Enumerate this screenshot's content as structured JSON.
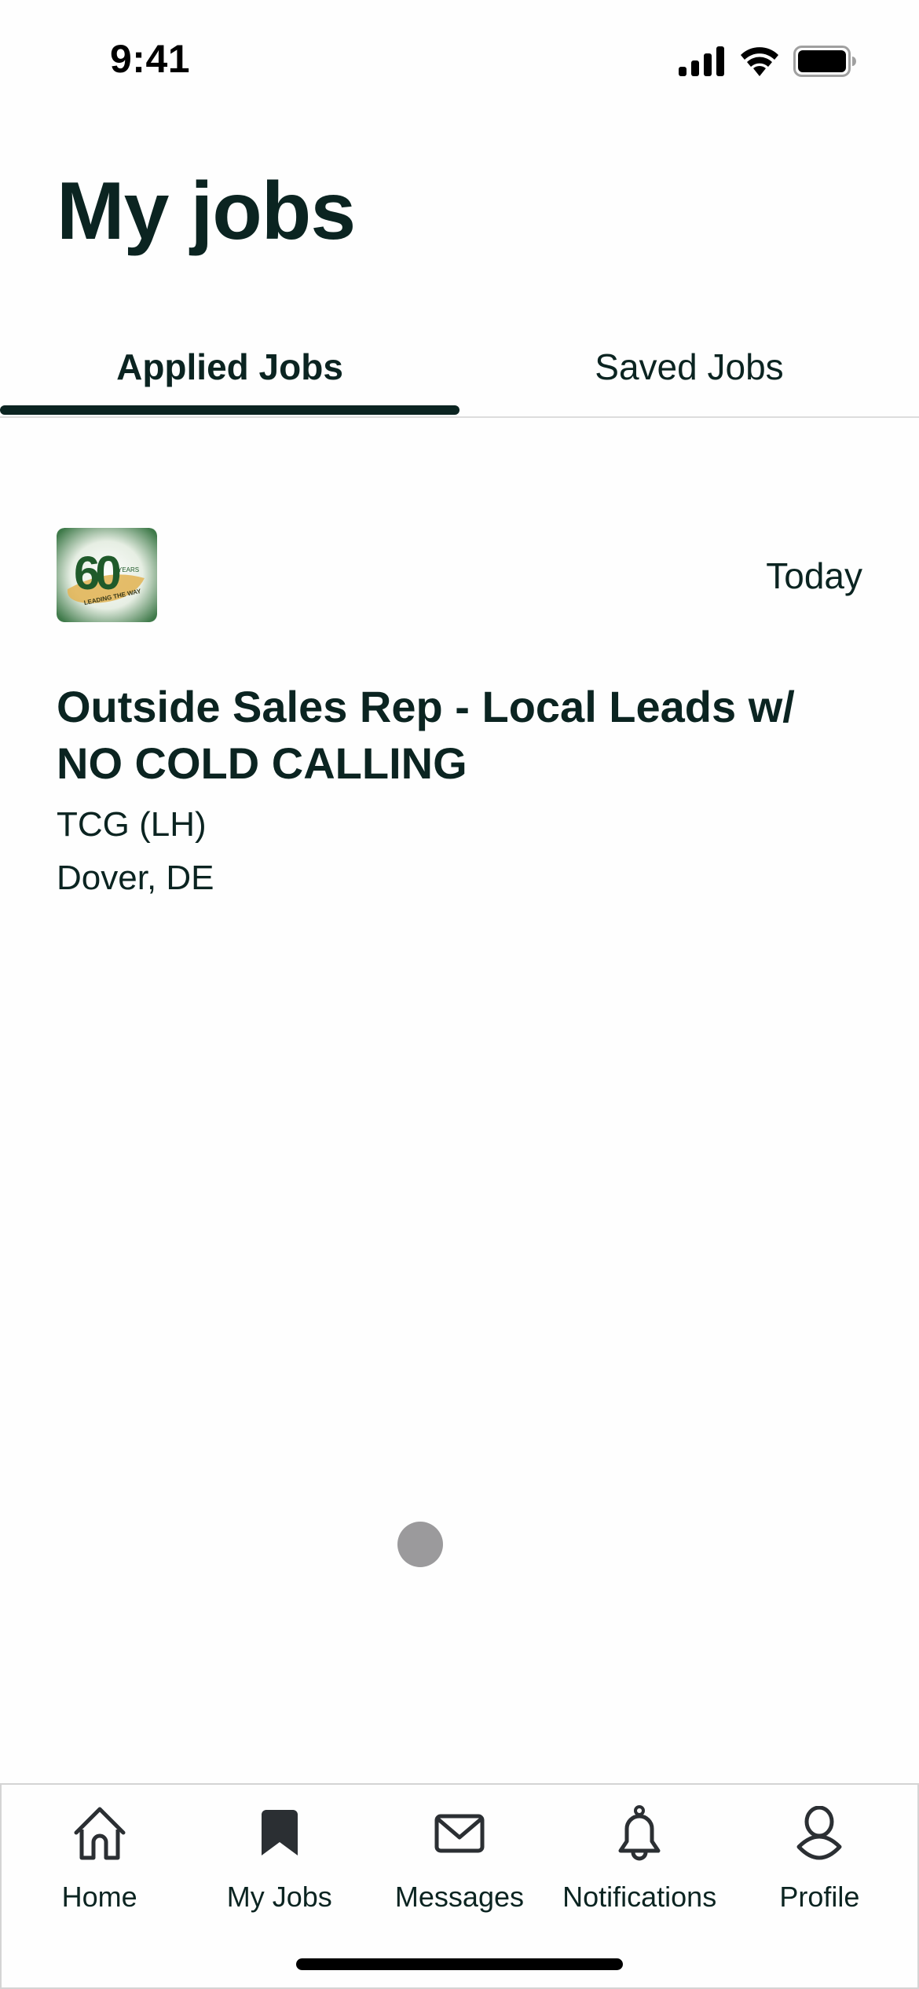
{
  "status_bar": {
    "time": "9:41",
    "icons": [
      "cellular-signal-icon",
      "wifi-icon",
      "battery-icon"
    ]
  },
  "header": {
    "title": "My jobs"
  },
  "tabs": [
    {
      "label": "Applied Jobs",
      "active": true
    },
    {
      "label": "Saved Jobs",
      "active": false
    }
  ],
  "jobs": [
    {
      "logo": {
        "alt": "60 Years Leading The Way",
        "number": "60",
        "subtitle": "YEARS",
        "ribbon": "LEADING THE WAY"
      },
      "date": "Today",
      "title": "Outside Sales Rep - Local Leads w/ NO COLD CALLING",
      "company": "TCG (LH)",
      "location": "Dover, DE"
    }
  ],
  "bottom_nav": [
    {
      "label": "Home",
      "icon": "home-icon",
      "active": false
    },
    {
      "label": "My Jobs",
      "icon": "bookmark-icon",
      "active": true
    },
    {
      "label": "Messages",
      "icon": "envelope-icon",
      "active": false
    },
    {
      "label": "Notifications",
      "icon": "bell-icon",
      "active": false
    },
    {
      "label": "Profile",
      "icon": "profile-icon",
      "active": false
    }
  ],
  "colors": {
    "text_primary": "#0b2421",
    "logo_green": "#1f5a2a",
    "logo_gold": "#e2b65a",
    "touch_indicator": "#9b9a9c"
  }
}
